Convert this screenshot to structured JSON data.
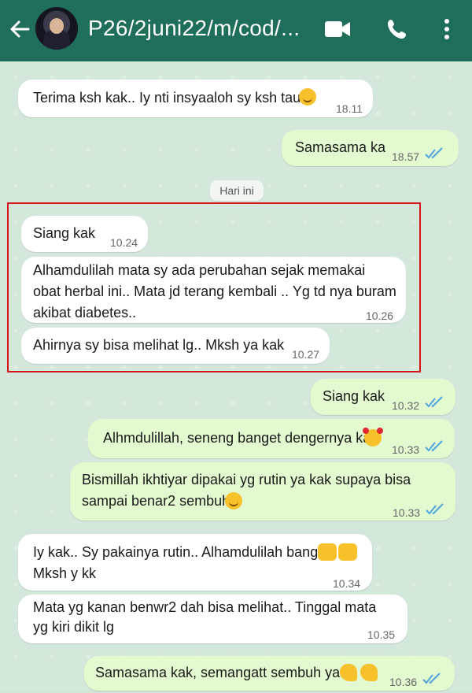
{
  "header": {
    "title": "P26/2juni22/m/cod/...",
    "background": "#1f6e5c",
    "icons": [
      "back-arrow-icon",
      "avatar",
      "video-call-icon",
      "voice-call-icon",
      "more-vert-icon"
    ]
  },
  "date_divider": "Hari ini",
  "messages": [
    {
      "dir": "in",
      "text": "Terima ksh kak.. Iy nti insyaaloh sy ksh tau",
      "emoji": "smile",
      "time": "18.11"
    },
    {
      "dir": "out",
      "text": "Samasama ka",
      "time": "18.57",
      "status": "read"
    },
    {
      "dir": "in",
      "text": "Siang kak",
      "time": "10.24"
    },
    {
      "dir": "in",
      "text": "Alhamdulilah mata sy ada perubahan sejak memakai obat herbal ini.. Mata jd terang kembali .. Yg td nya buram akibat diabetes..",
      "time": "10.26"
    },
    {
      "dir": "in",
      "text": "Ahirnya sy bisa melihat lg.. Mksh ya kak",
      "time": "10.27"
    },
    {
      "dir": "out",
      "text": "Siang kak",
      "time": "10.32",
      "status": "read"
    },
    {
      "dir": "out",
      "text": "Alhmdulillah, seneng banget dengernya kak",
      "emoji": "smiling-face-with-hearts",
      "time": "10.33",
      "status": "read"
    },
    {
      "dir": "out",
      "text": "Bismillah ikhtiyar dipakai yg rutin ya kak supaya bisa sampai benar2 sembuh",
      "emoji": "smile",
      "time": "10.33",
      "status": "read"
    },
    {
      "dir": "in",
      "text": "Iy kak.. Sy pakainya rutin.. Alhamdulilah banget",
      "emoji": "open-hands x2",
      "text2": "Mksh y kk",
      "time": "10.34"
    },
    {
      "dir": "in",
      "text": "Mata yg kanan benwr2 dah bisa melihat.. Tinggal mata yg kiri dikit lg",
      "time": "10.35"
    },
    {
      "dir": "out",
      "text": "Samasama kak, semangatt sembuh yaa",
      "emoji": "flexed-biceps x2",
      "time": "10.36",
      "status": "read"
    }
  ],
  "colors": {
    "incoming": "#ffffff",
    "outgoing": "#e3f9cf",
    "read_ticks": "#4fa3e0",
    "highlight_box": "#d4141c"
  }
}
